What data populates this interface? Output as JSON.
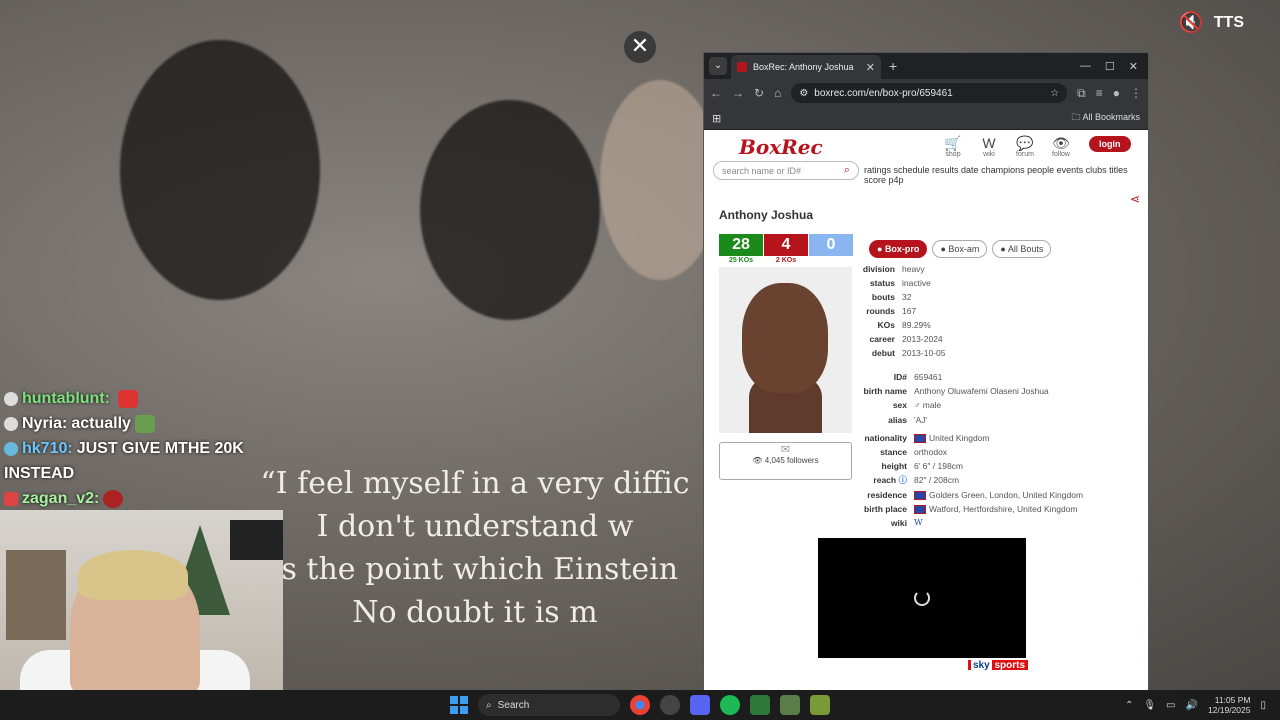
{
  "overlay": {
    "tts_label": "TTS",
    "close_glyph": "✕",
    "quote_lines": [
      "“I feel myself in a very diffic",
      "I don't understand w",
      "is the point which Einstein",
      "No doubt it is m"
    ]
  },
  "chat": [
    {
      "user": "huntablunt:",
      "message": ""
    },
    {
      "user": "Nyria:",
      "message": "actually"
    },
    {
      "user": "hk710:",
      "message": "JUST GIVE MTHE 20K"
    },
    {
      "user": "",
      "message": "INSTEAD"
    },
    {
      "user": "zagan_v2:",
      "message": ""
    }
  ],
  "browser": {
    "tab_title": "BoxRec: Anthony Joshua",
    "url": "boxrec.com/en/box-pro/659461",
    "bookmarks_label": "All Bookmarks"
  },
  "boxrec": {
    "logo": "BoxRec",
    "top_icons": [
      {
        "glyph": "🛒",
        "label": "shop"
      },
      {
        "glyph": "W",
        "label": "wiki"
      },
      {
        "glyph": "💬",
        "label": "forum"
      },
      {
        "glyph": "👁",
        "label": "follow"
      }
    ],
    "login_label": "login",
    "search_placeholder": "search name or ID#",
    "nav_links": "ratings schedule results date champions people events clubs titles score p4p",
    "boxer_name": "Anthony Joshua",
    "record": {
      "wins": "28",
      "losses": "4",
      "draws": "0",
      "wins_ko": "25 KOs",
      "losses_ko": "2 KOs"
    },
    "followers": "4,045 followers",
    "tabs": [
      "Box-pro",
      "Box-am",
      "All Bouts"
    ],
    "info": [
      {
        "k": "division",
        "v": "heavy"
      },
      {
        "k": "status",
        "v": "inactive"
      },
      {
        "k": "bouts",
        "v": "32"
      },
      {
        "k": "rounds",
        "v": "167"
      },
      {
        "k": "KOs",
        "v": "89.29%"
      },
      {
        "k": "career",
        "v": "2013-2024"
      },
      {
        "k": "debut",
        "v": "2013-10-05"
      }
    ],
    "details": [
      {
        "k": "ID#",
        "v": "659461"
      },
      {
        "k": "birth name",
        "v": "Anthony Oluwafemi Olaseni Joshua"
      },
      {
        "k": "sex",
        "v": "♂ male"
      },
      {
        "k": "alias",
        "v": "'AJ'"
      },
      {
        "k": "",
        "v": ""
      },
      {
        "k": "nationality",
        "v": "United Kingdom"
      },
      {
        "k": "stance",
        "v": "orthodox"
      },
      {
        "k": "height",
        "v": "6′ 6″   /   198cm"
      },
      {
        "k": "reach",
        "v": "82″   /   208cm"
      },
      {
        "k": "residence",
        "v": "Golders Green, London, United Kingdom"
      },
      {
        "k": "birth place",
        "v": "Watford, Hertfordshire, United Kingdom"
      },
      {
        "k": "wiki",
        "v": "W"
      }
    ],
    "sky_label_1": "sky",
    "sky_label_2": "sports"
  },
  "taskbar": {
    "search_label": "Search",
    "time": "11:05 PM",
    "date": "12/19/2025"
  },
  "colors": {
    "brand_red": "#b5141d",
    "win_green": "#1a8a1a",
    "draw_blue": "#8ab6f0"
  }
}
